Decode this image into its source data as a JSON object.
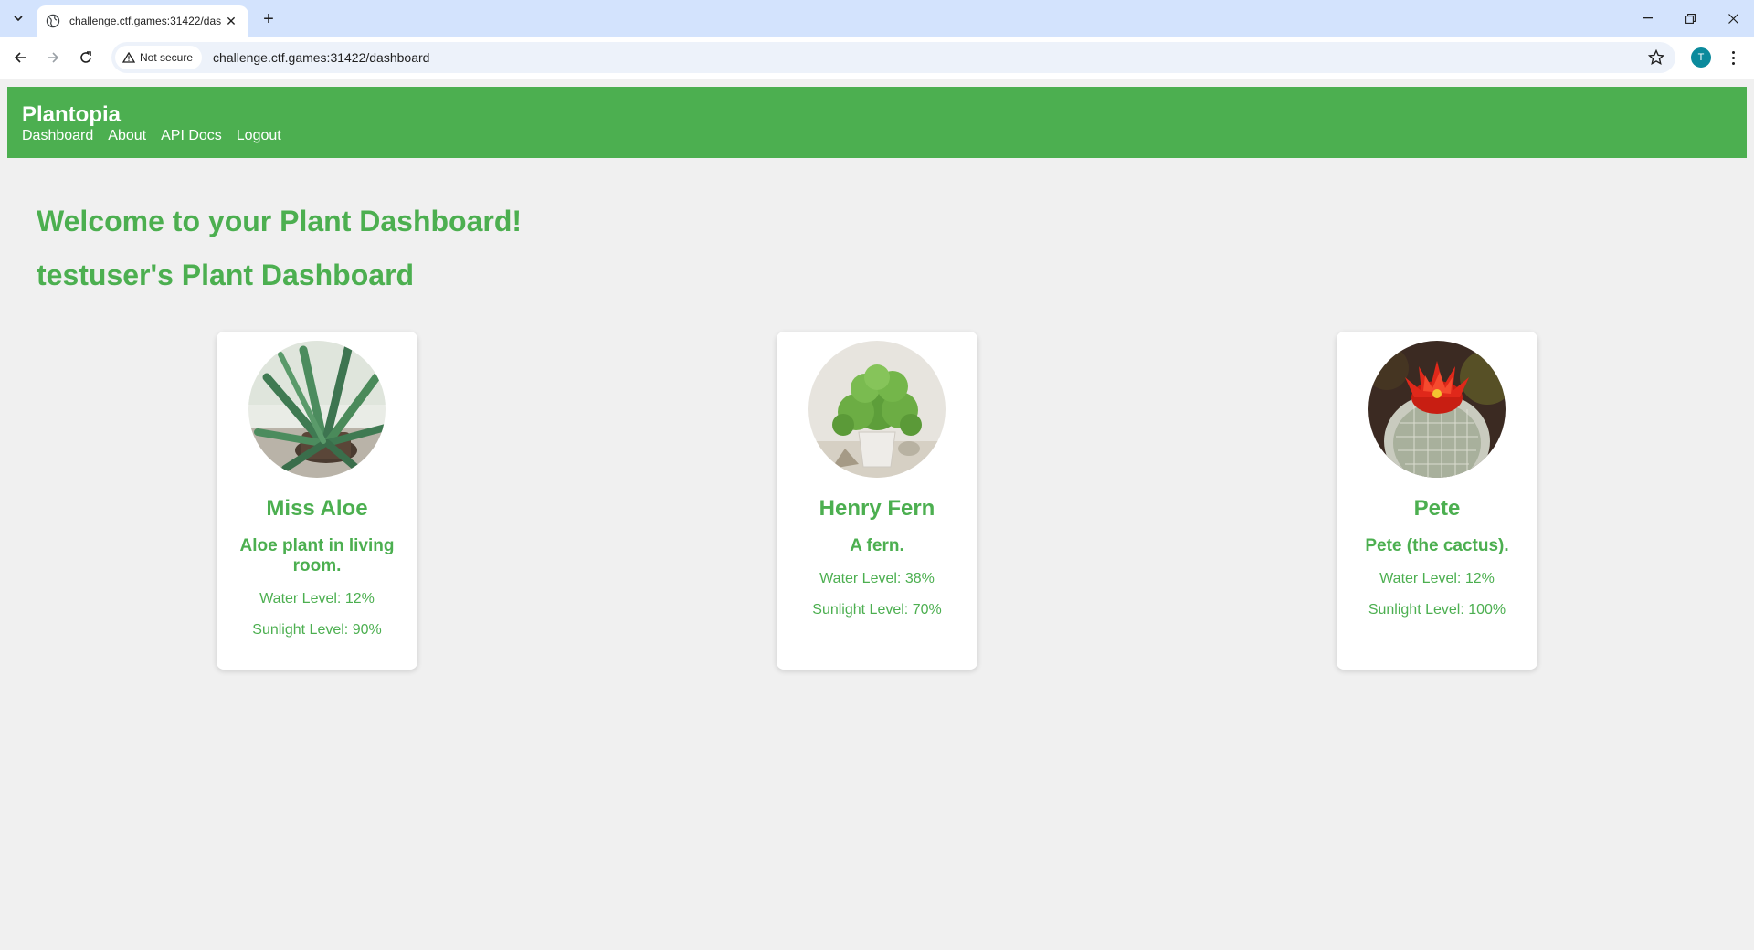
{
  "browser": {
    "tab_title": "challenge.ctf.games:31422/dashboard",
    "security_label": "Not secure",
    "url": "challenge.ctf.games:31422/dashboard",
    "profile_initial": "T"
  },
  "site": {
    "brand": "Plantopia",
    "nav": [
      "Dashboard",
      "About",
      "API Docs",
      "Logout"
    ],
    "accent_color": "#4caf50"
  },
  "main": {
    "heading": "Welcome to your Plant Dashboard!",
    "subheading": "testuser's Plant Dashboard"
  },
  "plants": [
    {
      "name": "Miss Aloe",
      "description": "Aloe plant in living room.",
      "water": "Water Level: 12%",
      "sunlight": "Sunlight Level: 90%"
    },
    {
      "name": "Henry Fern",
      "description": "A fern.",
      "water": "Water Level: 38%",
      "sunlight": "Sunlight Level: 70%"
    },
    {
      "name": "Pete",
      "description": "Pete (the cactus).",
      "water": "Water Level: 12%",
      "sunlight": "Sunlight Level: 100%"
    }
  ]
}
